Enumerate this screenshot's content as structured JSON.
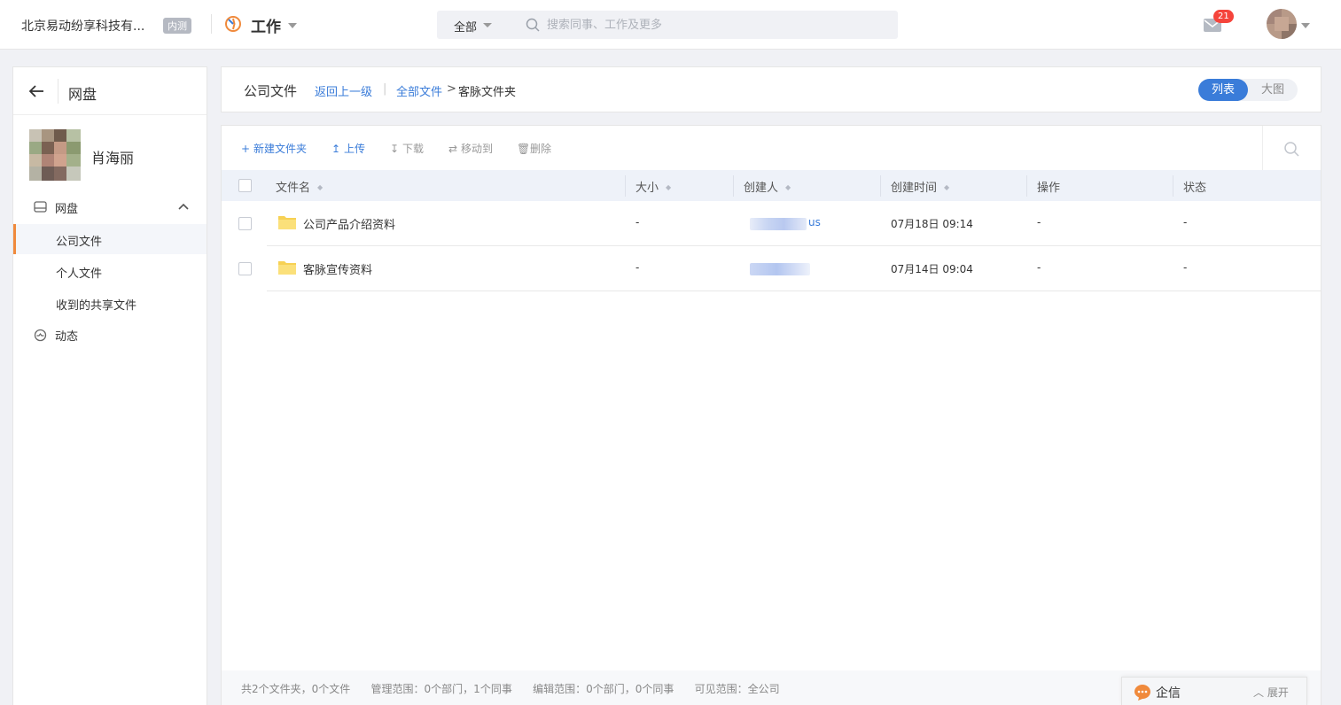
{
  "topbar": {
    "company": "北京易动纷享科技有...",
    "company_badge": "内测",
    "app_label": "工作",
    "search_scope": "全部",
    "search_placeholder": "搜索同事、工作及更多",
    "message_count": "21"
  },
  "sidebar": {
    "title": "网盘",
    "user_name": "肖海丽",
    "nav_drive": "网盘",
    "sub_items": [
      "公司文件",
      "个人文件",
      "收到的共享文件"
    ],
    "nav_activity": "动态"
  },
  "header": {
    "title": "公司文件",
    "back_link": "返回上一级",
    "separator": "|",
    "crumb_root": "全部文件",
    "crumb_gt": ">",
    "crumb_current": "客脉文件夹",
    "view_list": "列表",
    "view_grid": "大图"
  },
  "toolbar": {
    "new_folder": "新建文件夹",
    "upload": "上传",
    "download": "下载",
    "move": "移动到",
    "delete": "删除"
  },
  "table": {
    "columns": [
      "文件名",
      "大小",
      "创建人",
      "创建时间",
      "操作",
      "状态"
    ],
    "rows": [
      {
        "name": "公司产品介绍资料",
        "size": "-",
        "creator_suffix": "us",
        "created": "07月18日 09:14",
        "action": "-",
        "status": "-"
      },
      {
        "name": "客脉宣传资料",
        "size": "-",
        "creator_suffix": "",
        "created": "07月14日 09:04",
        "action": "-",
        "status": "-"
      }
    ]
  },
  "footer": {
    "summary": "共2个文件夹，0个文件",
    "manage_scope": "管理范围：0个部门，1个同事",
    "edit_scope": "编辑范围：0个部门，0个同事",
    "visible_scope": "可见范围：全公司"
  },
  "qixin": {
    "label": "企信",
    "expand": "展开"
  },
  "colors": {
    "accent": "#3a7cd9",
    "active_bar": "#f08a3c",
    "badge": "#f5443b",
    "folder": "#f7d154"
  }
}
